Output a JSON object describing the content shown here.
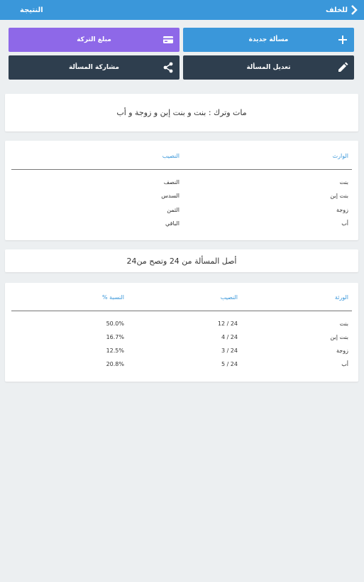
{
  "header": {
    "back_label": "للخلف",
    "title": "النتيجة"
  },
  "actions": {
    "new_problem": "مسألة جديدة",
    "estate_amount": "مبلغ التركة",
    "edit_problem": "تعديل المسألة",
    "share_problem": "مشاركة المسألة"
  },
  "question": "مات وترك : بنت و بنت إبن و زوجة و أب",
  "shares_table": {
    "headers": {
      "heir": "الوارث",
      "share": "النصيب"
    },
    "rows": [
      {
        "heir": "بنت",
        "share": "النصف"
      },
      {
        "heir": "بنت إبن",
        "share": "السدس"
      },
      {
        "heir": "زوجة",
        "share": "الثمن"
      },
      {
        "heir": "أب",
        "share": "الباقي"
      }
    ]
  },
  "origin_text": "أصل المسألة من 24 وتصح من24",
  "result_table": {
    "headers": {
      "heir": "الورثة",
      "share": "النصيب",
      "percent": "النسبة %"
    },
    "rows": [
      {
        "heir": "بنت",
        "share": "12 / 24",
        "percent": "50.0%"
      },
      {
        "heir": "بنت إبن",
        "share": "4 / 24",
        "percent": "16.7%"
      },
      {
        "heir": "زوجة",
        "share": "3 / 24",
        "percent": "12.5%"
      },
      {
        "heir": "أب",
        "share": "5 / 24",
        "percent": "20.8%"
      }
    ]
  },
  "icons": {
    "back": "chevron-right-icon",
    "add": "plus-icon",
    "money": "credit-card-icon",
    "edit": "pencil-icon",
    "share": "share-icon"
  },
  "colors": {
    "primary": "#3a97da",
    "purple": "#8e68e8",
    "dark": "#2e3e4e",
    "background": "#eceff1"
  }
}
